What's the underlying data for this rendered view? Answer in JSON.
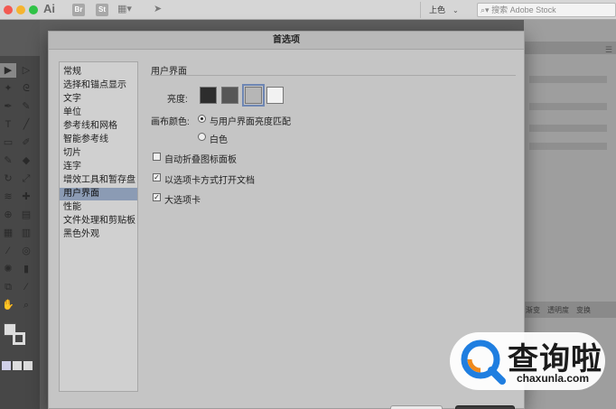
{
  "app": {
    "logo": "Ai",
    "icons": [
      "Br",
      "St"
    ],
    "workspace": "上色",
    "search_placeholder": "搜索 Adobe Stock"
  },
  "dialog": {
    "title": "首选项",
    "nav_items": [
      {
        "label": "常规",
        "selected": false
      },
      {
        "label": "选择和锚点显示",
        "selected": false
      },
      {
        "label": "文字",
        "selected": false
      },
      {
        "label": "单位",
        "selected": false
      },
      {
        "label": "参考线和网格",
        "selected": false
      },
      {
        "label": "智能参考线",
        "selected": false
      },
      {
        "label": "切片",
        "selected": false
      },
      {
        "label": "连字",
        "selected": false
      },
      {
        "label": "增效工具和暂存盘",
        "selected": false
      },
      {
        "label": "用户界面",
        "selected": true
      },
      {
        "label": "性能",
        "selected": false
      },
      {
        "label": "文件处理和剪贴板",
        "selected": false
      },
      {
        "label": "黑色外观",
        "selected": false
      }
    ],
    "section_title": "用户界面",
    "brightness_label": "亮度:",
    "brightness_swatches": [
      "#2d2d2d",
      "#575757",
      "#b6b6b6",
      "#f2f2f2"
    ],
    "brightness_selected_index": 2,
    "canvas_color_label": "画布颜色:",
    "canvas_color_options": [
      {
        "label": "与用户界面亮度匹配",
        "checked": true
      },
      {
        "label": "白色",
        "checked": false
      }
    ],
    "checkboxes": [
      {
        "label": "自动折叠图标面板",
        "checked": false
      },
      {
        "label": "以选项卡方式打开文档",
        "checked": true
      },
      {
        "label": "大选项卡",
        "checked": true
      }
    ]
  },
  "right_panel": {
    "tabs": [
      "渐变",
      "透明度",
      "变换"
    ]
  },
  "watermark": {
    "text": "查询啦",
    "url": "chaxunla.com",
    "colors": {
      "blue": "#1f7ee0",
      "orange": "#f08a1c"
    }
  }
}
